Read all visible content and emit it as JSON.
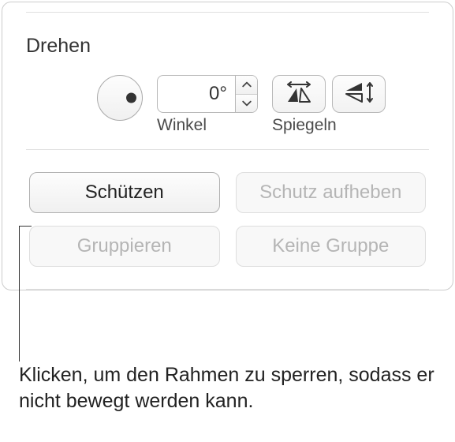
{
  "rotate": {
    "title": "Drehen",
    "angle_value": "0°",
    "angle_label": "Winkel",
    "flip_label": "Spiegeln"
  },
  "buttons": {
    "lock": "Schützen",
    "unlock": "Schutz aufheben",
    "group": "Gruppieren",
    "ungroup": "Keine Gruppe"
  },
  "callout": {
    "text": "Klicken, um den Rahmen zu sperren, sodass er nicht bewegt werden kann."
  }
}
